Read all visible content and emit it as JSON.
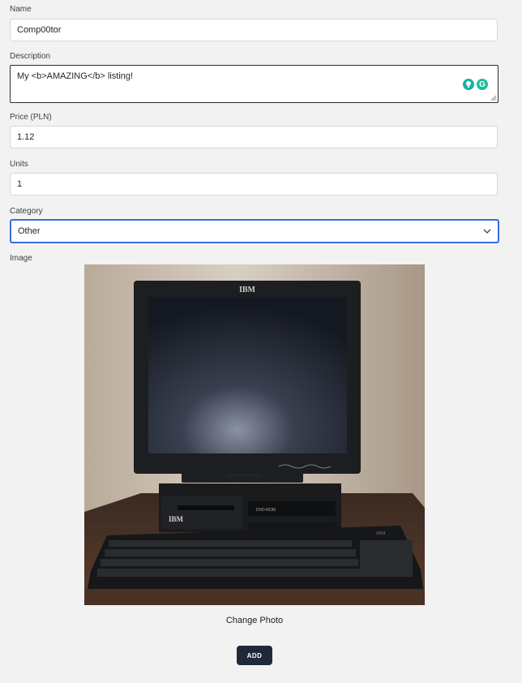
{
  "form": {
    "name": {
      "label": "Name",
      "value": "Comp00tor"
    },
    "description": {
      "label": "Description",
      "value": "My <b>AMAZING</b> listing!"
    },
    "price": {
      "label": "Price (PLN)",
      "value": "1.12"
    },
    "units": {
      "label": "Units",
      "value": "1"
    },
    "category": {
      "label": "Category",
      "selected": "Other"
    },
    "image": {
      "label": "Image",
      "photo_brand": "IBM",
      "drive_label": "DVD-ROM"
    },
    "change_photo_label": "Change Photo",
    "submit_label": "ADD"
  },
  "colors": {
    "page_bg": "#f2f2f2",
    "focus_border": "#3b6fd8",
    "button_bg": "#1e2a3a",
    "grammarly": "#15c39a"
  },
  "icons": [
    "grammarly-bulb-icon",
    "grammarly-g-icon",
    "resize-grip-icon",
    "chevron-down-icon"
  ]
}
